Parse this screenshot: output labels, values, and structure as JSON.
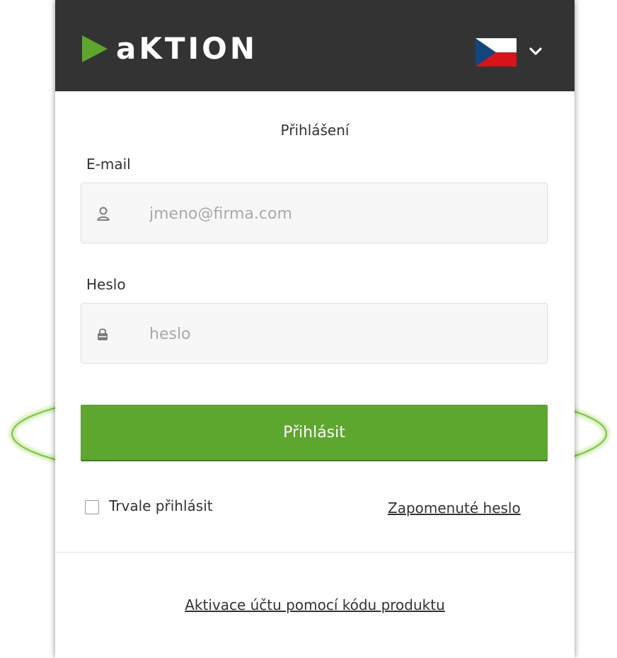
{
  "header": {
    "logo_text": "aKTION",
    "language": {
      "icon": "czech-flag-icon",
      "selector_icon": "chevron-down-icon"
    }
  },
  "form": {
    "title": "Přihlášení",
    "email": {
      "label": "E-mail",
      "placeholder": "jmeno@firma.com",
      "value": "",
      "icon": "user-icon"
    },
    "password": {
      "label": "Heslo",
      "placeholder": "heslo",
      "value": "",
      "icon": "lock-icon"
    },
    "submit_label": "Přihlásit",
    "remember_label": "Trvale přihlásit",
    "remember_checked": false,
    "forgot_label": "Zapomenuté heslo"
  },
  "footer": {
    "activate_label": "Aktivace účtu pomocí kódu produktu"
  },
  "colors": {
    "header_bg": "#333333",
    "brand_green": "#5ea72f",
    "highlight_green": "#8dd14a"
  }
}
